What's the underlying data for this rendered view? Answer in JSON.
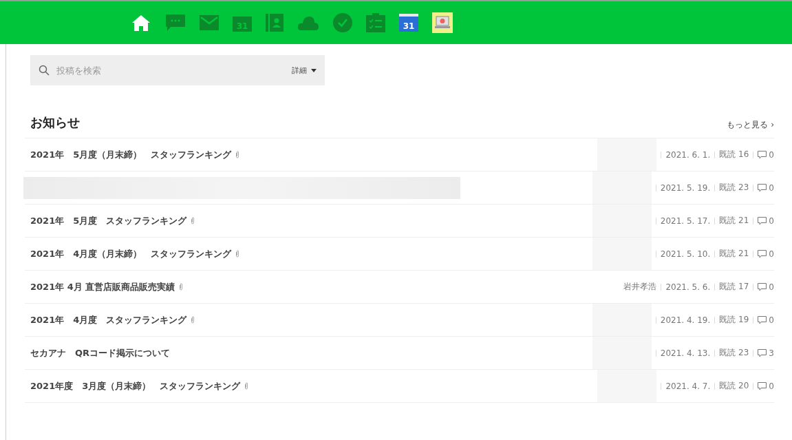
{
  "nav": [
    {
      "kind": "home",
      "selected": true
    },
    {
      "kind": "chat",
      "selected": false
    },
    {
      "kind": "mail",
      "selected": false
    },
    {
      "kind": "calendar",
      "label": "31",
      "selected": false
    },
    {
      "kind": "contacts",
      "selected": false
    },
    {
      "kind": "cloud",
      "selected": false
    },
    {
      "kind": "check",
      "selected": false
    },
    {
      "kind": "tasks",
      "selected": false
    },
    {
      "kind": "app-calendar",
      "label": "31",
      "selected": false
    },
    {
      "kind": "app-monitor",
      "selected": false
    }
  ],
  "search": {
    "placeholder": "投稿を検索",
    "detail": "詳細"
  },
  "section": {
    "title": "お知らせ",
    "more": "もっと見る ›"
  },
  "posts": [
    {
      "title": "2021年　5月度（月末締）　スタッフランキング",
      "title_redacted": false,
      "attachment": true,
      "author_redacted": true,
      "date": "2021. 6. 1.",
      "reads": "既読 16",
      "comments": "0"
    },
    {
      "title_redacted": true,
      "attachment": false,
      "author_redacted": true,
      "date": "2021. 5. 19.",
      "reads": "既読 23",
      "comments": "0"
    },
    {
      "title": "2021年　5月度　スタッフランキング",
      "title_redacted": false,
      "attachment": true,
      "author_redacted": true,
      "date": "2021. 5. 17.",
      "reads": "既読 21",
      "comments": "0"
    },
    {
      "title": "2021年　4月度（月末締）　スタッフランキング",
      "title_redacted": false,
      "attachment": true,
      "author_redacted": true,
      "date": "2021. 5. 10.",
      "reads": "既読 21",
      "comments": "0"
    },
    {
      "title": "2021年 4月 直営店販商品販売実績",
      "title_redacted": false,
      "attachment": true,
      "author": "岩井孝浩",
      "author_redacted": false,
      "date": "2021. 5. 6.",
      "reads": "既読 17",
      "comments": "0"
    },
    {
      "title": "2021年　4月度　スタッフランキング",
      "title_redacted": false,
      "attachment": true,
      "author_redacted": true,
      "date": "2021. 4. 19.",
      "reads": "既読 19",
      "comments": "0"
    },
    {
      "title": "セカアナ　QRコード掲示について",
      "title_redacted": false,
      "attachment": false,
      "author_redacted": true,
      "date": "2021. 4. 13.",
      "reads": "既読 23",
      "comments": "3"
    },
    {
      "title": "2021年度　3月度（月末締）　スタッフランキング",
      "title_redacted": false,
      "attachment": true,
      "author_redacted": true,
      "date": "2021. 4. 7.",
      "reads": "既読 20",
      "comments": "0"
    }
  ]
}
